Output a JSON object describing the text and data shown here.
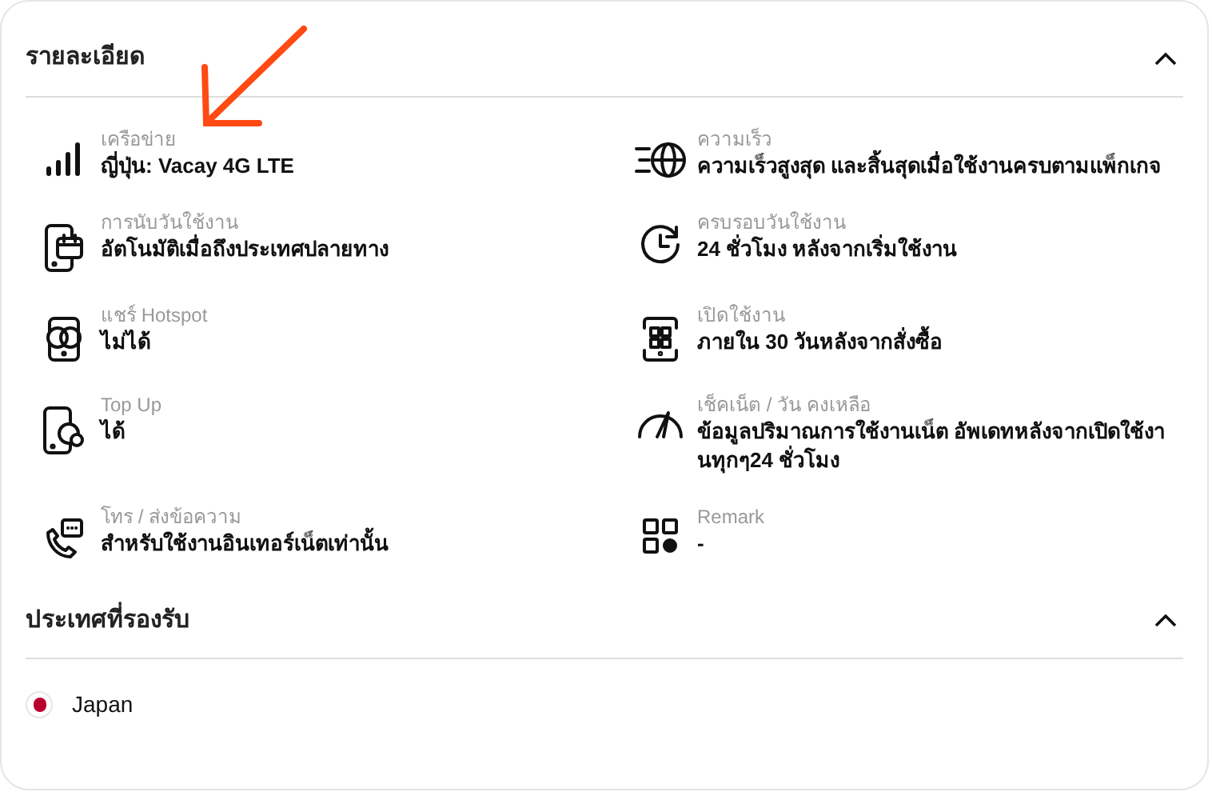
{
  "sections": [
    {
      "title": "รายละเอียด",
      "expanded": true,
      "items": [
        {
          "label": "เครือข่าย",
          "value": "ญี่ปุ่น: Vacay 4G LTE"
        },
        {
          "label": "ความเร็ว",
          "value": "ความเร็วสูงสุด และสิ้นสุดเมื่อใช้งานครบตามแพ็กเกจ"
        },
        {
          "label": "การนับวันใช้งาน",
          "value": "อัตโนมัติเมื่อถึงประเทศปลายทาง"
        },
        {
          "label": "ครบรอบวันใช้งาน",
          "value": "24 ชั่วโมง หลังจากเริ่มใช้งาน"
        },
        {
          "label": "แชร์ Hotspot",
          "value": "ไม่ได้"
        },
        {
          "label": "เปิดใช้งาน",
          "value": "ภายใน 30 วันหลังจากสั่งซื้อ"
        },
        {
          "label": "Top Up",
          "value": "ได้"
        },
        {
          "label": "เช็คเน็ต / วัน คงเหลือ",
          "value": "ข้อมูลปริมาณการใช้งานเน็ต อัพเดทหลังจากเปิดใช้งานทุกๆ24 ชั่วโมง"
        },
        {
          "label": "โทร / ส่งข้อความ",
          "value": "สำหรับใช้งานอินเทอร์เน็ตเท่านั้น"
        },
        {
          "label": "Remark",
          "value": "-"
        }
      ]
    },
    {
      "title": "ประเทศที่รองรับ",
      "expanded": true,
      "countries": [
        {
          "name": "Japan",
          "color": "#bc002d"
        }
      ]
    }
  ]
}
